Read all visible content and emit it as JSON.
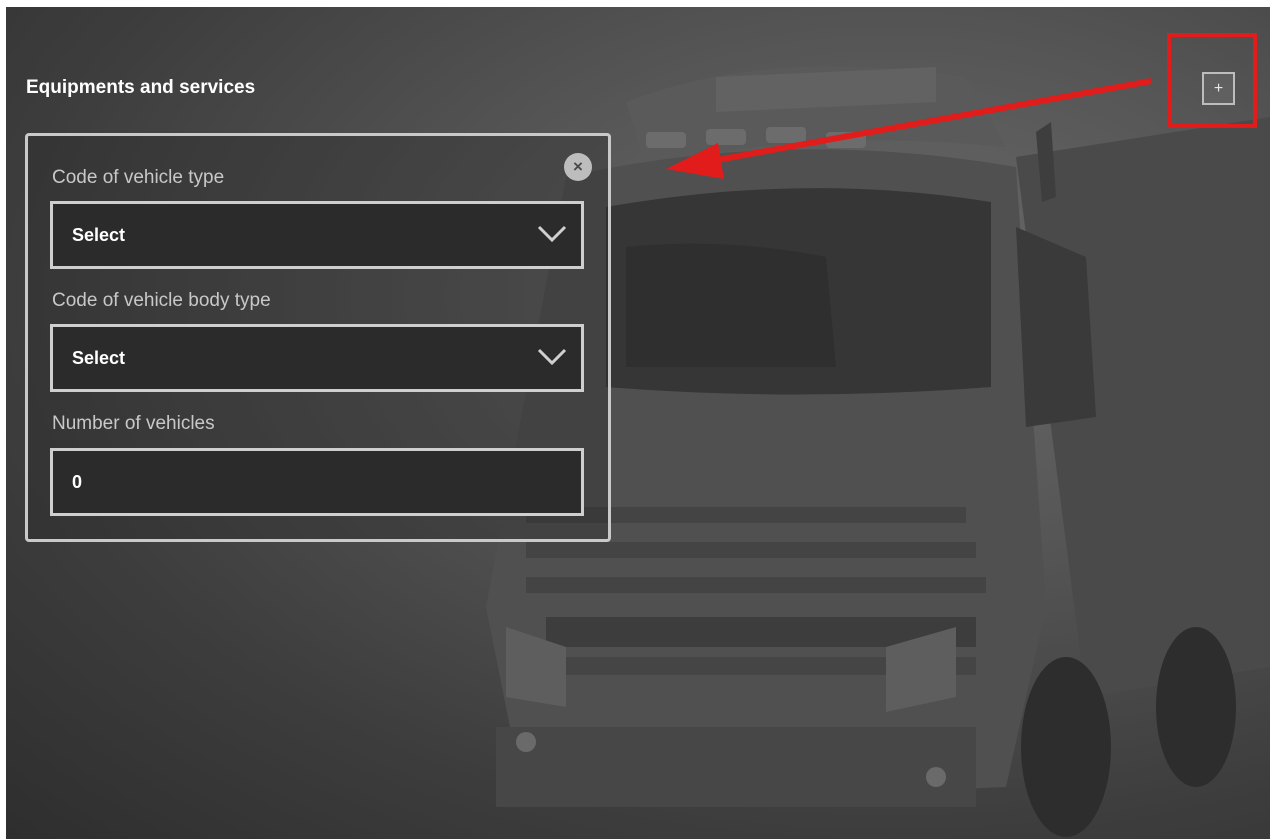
{
  "section": {
    "title": "Equipments and services"
  },
  "toolbar": {
    "add_label": "+"
  },
  "form": {
    "close_label": "×",
    "vehicle_type": {
      "label": "Code of vehicle type",
      "value": "Select"
    },
    "body_type": {
      "label": "Code of vehicle body type",
      "value": "Select"
    },
    "vehicle_count": {
      "label": "Number of vehicles",
      "value": "0"
    }
  },
  "colors": {
    "highlight": "#e21b1b",
    "text": "#ffffff",
    "label": "#c8c8c8"
  },
  "icons": {
    "add": "plus-icon",
    "close": "close-icon",
    "dropdown": "chevron-down-icon"
  }
}
